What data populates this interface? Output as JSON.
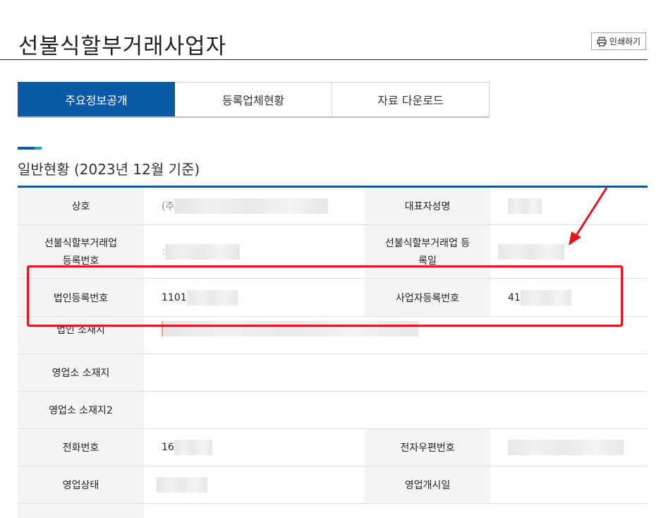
{
  "page": {
    "title": "선불식할부거래사업자",
    "print_label": "인쇄하기"
  },
  "tabs": [
    {
      "label": "주요정보공개",
      "active": true
    },
    {
      "label": "등록업체현황",
      "active": false
    },
    {
      "label": "자료 다운로드",
      "active": false
    }
  ],
  "section": {
    "title": "일반현황 (2023년 12월 기준)"
  },
  "table": {
    "trade_name": {
      "label": "상호",
      "value_prefix": "(주"
    },
    "ceo_name": {
      "label": "대표자성명"
    },
    "reg_number": {
      "label": "선불식할부거래업 등록번호",
      "value_prefix": ":"
    },
    "reg_date": {
      "label": "선불식할부거래업 등록일"
    },
    "corp_reg_number": {
      "label": "법인등록번호",
      "value_prefix": "1101"
    },
    "business_reg_number": {
      "label": "사업자등록번호",
      "value_prefix": "41"
    },
    "corp_address": {
      "label": "법인 소재지"
    },
    "office_address": {
      "label": "영업소 소재지"
    },
    "office_address2": {
      "label": "영업소 소재지2"
    },
    "phone": {
      "label": "전화번호",
      "value_prefix": "16"
    },
    "email": {
      "label": "전자우편번호"
    },
    "status": {
      "label": "영업상태"
    },
    "open_date": {
      "label": "영업개시일"
    }
  },
  "colors": {
    "accent": "#0b5aa7",
    "highlight": "#e8141b",
    "header_bg": "#f3f4f6"
  }
}
